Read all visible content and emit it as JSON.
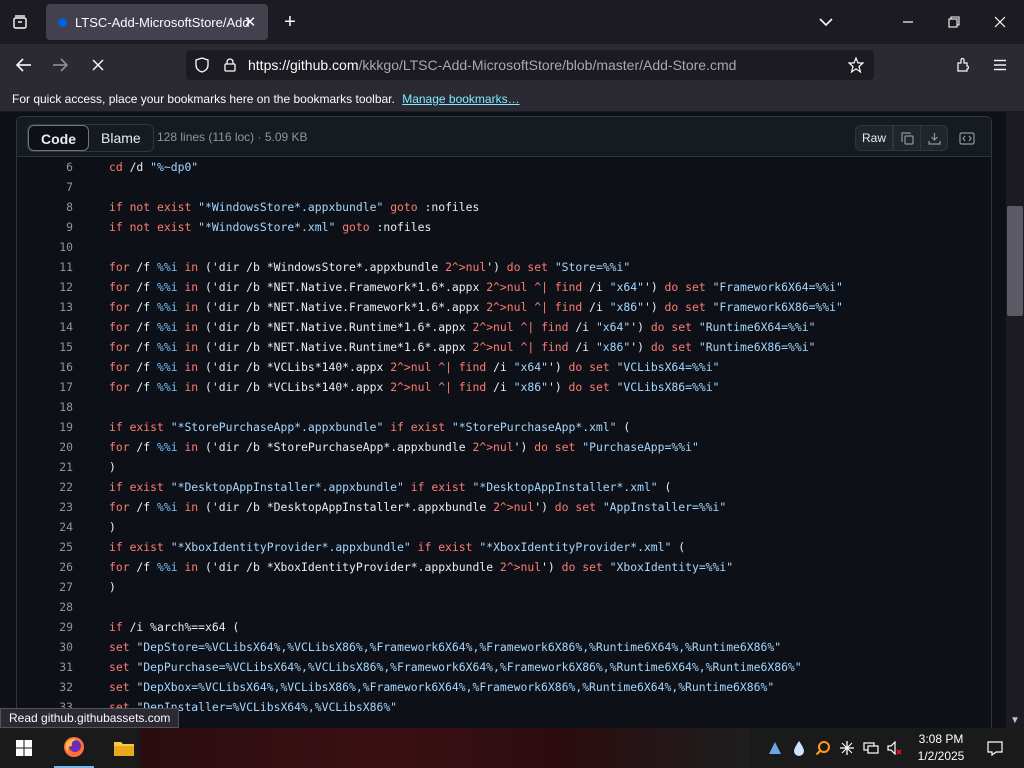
{
  "browser": {
    "tab_title": "LTSC-Add-MicrosoftStore/Add",
    "url_host": "https://github.com",
    "url_path": "/kkkgo/LTSC-Add-MicrosoftStore/blob/master/Add-Store.cmd",
    "bookmarks_hint": "For quick access, place your bookmarks here on the bookmarks toolbar.",
    "bookmarks_link": "Manage bookmarks…",
    "status_text": "Read github.githubassets.com"
  },
  "file": {
    "tab_code": "Code",
    "tab_blame": "Blame",
    "info": "128 lines (116 loc) · 5.09 KB",
    "raw_label": "Raw"
  },
  "code_lines": [
    {
      "n": "6",
      "t": "cd /d \"%~dp0\""
    },
    {
      "n": "7",
      "t": ""
    },
    {
      "n": "8",
      "t": "if not exist \"*WindowsStore*.appxbundle\" goto :nofiles"
    },
    {
      "n": "9",
      "t": "if not exist \"*WindowsStore*.xml\" goto :nofiles"
    },
    {
      "n": "10",
      "t": ""
    },
    {
      "n": "11",
      "t": "for /f %%i in ('dir /b *WindowsStore*.appxbundle 2^>nul') do set \"Store=%%i\""
    },
    {
      "n": "12",
      "t": "for /f %%i in ('dir /b *NET.Native.Framework*1.6*.appx 2^>nul ^| find /i \"x64\"') do set \"Framework6X64=%%i\""
    },
    {
      "n": "13",
      "t": "for /f %%i in ('dir /b *NET.Native.Framework*1.6*.appx 2^>nul ^| find /i \"x86\"') do set \"Framework6X86=%%i\""
    },
    {
      "n": "14",
      "t": "for /f %%i in ('dir /b *NET.Native.Runtime*1.6*.appx 2^>nul ^| find /i \"x64\"') do set \"Runtime6X64=%%i\""
    },
    {
      "n": "15",
      "t": "for /f %%i in ('dir /b *NET.Native.Runtime*1.6*.appx 2^>nul ^| find /i \"x86\"') do set \"Runtime6X86=%%i\""
    },
    {
      "n": "16",
      "t": "for /f %%i in ('dir /b *VCLibs*140*.appx 2^>nul ^| find /i \"x64\"') do set \"VCLibsX64=%%i\""
    },
    {
      "n": "17",
      "t": "for /f %%i in ('dir /b *VCLibs*140*.appx 2^>nul ^| find /i \"x86\"') do set \"VCLibsX86=%%i\""
    },
    {
      "n": "18",
      "t": ""
    },
    {
      "n": "19",
      "t": "if exist \"*StorePurchaseApp*.appxbundle\" if exist \"*StorePurchaseApp*.xml\" ("
    },
    {
      "n": "20",
      "t": "for /f %%i in ('dir /b *StorePurchaseApp*.appxbundle 2^>nul') do set \"PurchaseApp=%%i\""
    },
    {
      "n": "21",
      "t": ")"
    },
    {
      "n": "22",
      "t": "if exist \"*DesktopAppInstaller*.appxbundle\" if exist \"*DesktopAppInstaller*.xml\" ("
    },
    {
      "n": "23",
      "t": "for /f %%i in ('dir /b *DesktopAppInstaller*.appxbundle 2^>nul') do set \"AppInstaller=%%i\""
    },
    {
      "n": "24",
      "t": ")"
    },
    {
      "n": "25",
      "t": "if exist \"*XboxIdentityProvider*.appxbundle\" if exist \"*XboxIdentityProvider*.xml\" ("
    },
    {
      "n": "26",
      "t": "for /f %%i in ('dir /b *XboxIdentityProvider*.appxbundle 2^>nul') do set \"XboxIdentity=%%i\""
    },
    {
      "n": "27",
      "t": ")"
    },
    {
      "n": "28",
      "t": ""
    },
    {
      "n": "29",
      "t": "if /i %arch%==x64 ("
    },
    {
      "n": "30",
      "t": "set \"DepStore=%VCLibsX64%,%VCLibsX86%,%Framework6X64%,%Framework6X86%,%Runtime6X64%,%Runtime6X86%\""
    },
    {
      "n": "31",
      "t": "set \"DepPurchase=%VCLibsX64%,%VCLibsX86%,%Framework6X64%,%Framework6X86%,%Runtime6X64%,%Runtime6X86%\""
    },
    {
      "n": "32",
      "t": "set \"DepXbox=%VCLibsX64%,%VCLibsX86%,%Framework6X64%,%Framework6X86%,%Runtime6X64%,%Runtime6X86%\""
    },
    {
      "n": "33",
      "t": "set \"DepInstaller=%VCLibsX64%,%VCLibsX86%\""
    }
  ],
  "taskbar": {
    "time": "3:08 PM",
    "date": "1/2/2025"
  }
}
